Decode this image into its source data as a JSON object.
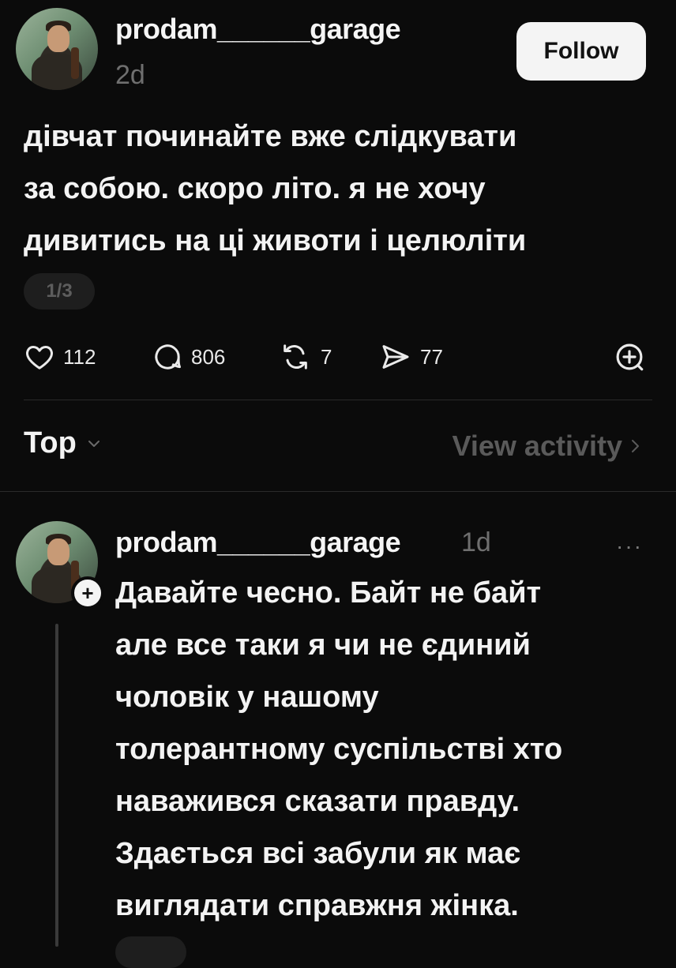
{
  "post": {
    "username": "prodam______garage",
    "time": "2d",
    "follow_label": "Follow",
    "text_lines": [
      "дівчат починайте вже слідкувати",
      "за собою. скоро літо. я не хочу",
      "дивитись на ці животи і целюліти"
    ],
    "page_indicator": "1/3",
    "actions": {
      "likes": "112",
      "comments": "806",
      "reposts": "7",
      "shares": "77"
    }
  },
  "replies_header": {
    "sort_label": "Top",
    "view_activity_label": "View activity"
  },
  "reply": {
    "username": "prodam______garage",
    "time": "1d",
    "more": "···",
    "text_lines": [
      "Давайте чесно. Байт не байт",
      "але все таки я чи не єдиний",
      "чоловік у нашому",
      "толерантному суспільстві хто",
      "наважився сказати правду.",
      "Здається всі забули як має",
      "виглядати справжня жінка."
    ]
  },
  "icons": {
    "like": "heart-icon",
    "comment": "comment-bubble-icon",
    "repost": "repost-icon",
    "share": "send-icon",
    "save": "add-circle-icon"
  }
}
